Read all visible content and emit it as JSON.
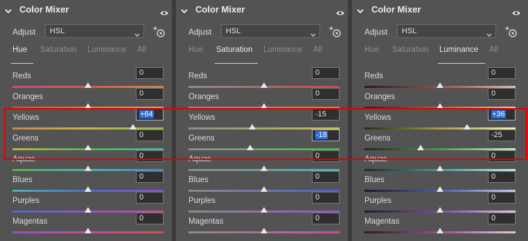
{
  "panels": [
    {
      "title": "Color Mixer",
      "adjust_label": "Adjust",
      "adjust_value": "HSL",
      "tabs": [
        "Hue",
        "Saturation",
        "Luminance",
        "All"
      ],
      "active_tab": 0,
      "rows": [
        {
          "label": "Reds",
          "value": "0",
          "slider": 0.5,
          "track": "linear-gradient(90deg,#c14f8c,#c9604a,#c98a4a)"
        },
        {
          "label": "Oranges",
          "value": "0",
          "slider": 0.5,
          "track": "linear-gradient(90deg,#c5584f,#c98a4a,#c7b64d)"
        },
        {
          "label": "Yellows",
          "value": "+64",
          "slider": 0.8,
          "selected": true,
          "track": "linear-gradient(90deg,#c98a4a,#c7b64d,#8fb84e)"
        },
        {
          "label": "Greens",
          "value": "0",
          "slider": 0.5,
          "track": "linear-gradient(90deg,#b4b74c,#5cb04f,#4eb49a)"
        },
        {
          "label": "Aquas",
          "value": "0",
          "slider": 0.5,
          "track": "linear-gradient(90deg,#5cb04f,#4cb3b5,#4d87c3)"
        },
        {
          "label": "Blues",
          "value": "0",
          "slider": 0.5,
          "track": "linear-gradient(90deg,#4cb3b5,#4f6cc6,#8a4fc3)"
        },
        {
          "label": "Purples",
          "value": "0",
          "slider": 0.5,
          "track": "linear-gradient(90deg,#4f6cc6,#9a4fc3,#c14f9e)"
        },
        {
          "label": "Magentas",
          "value": "0",
          "slider": 0.5,
          "track": "linear-gradient(90deg,#9a4fc3,#c14f9e,#c5584f)"
        }
      ]
    },
    {
      "title": "Color Mixer",
      "adjust_label": "Adjust",
      "adjust_value": "HSL",
      "tabs": [
        "Hue",
        "Saturation",
        "Luminance",
        "All"
      ],
      "active_tab": 1,
      "rows": [
        {
          "label": "Reds",
          "value": "0",
          "slider": 0.5,
          "track": "linear-gradient(90deg,#8c8c8c,#c94a4a)"
        },
        {
          "label": "Oranges",
          "value": "0",
          "slider": 0.5,
          "track": "linear-gradient(90deg,#8c8c8c,#c98a4a)"
        },
        {
          "label": "Yellows",
          "value": "-15",
          "slider": 0.42,
          "track": "linear-gradient(90deg,#8c8c8c,#c7c24d)"
        },
        {
          "label": "Greens",
          "value": "-18",
          "slider": 0.41,
          "selected": true,
          "track": "linear-gradient(90deg,#8c8c8c,#4fb550)"
        },
        {
          "label": "Aquas",
          "value": "0",
          "slider": 0.5,
          "track": "linear-gradient(90deg,#8c8c8c,#4cb6b8)"
        },
        {
          "label": "Blues",
          "value": "0",
          "slider": 0.5,
          "track": "linear-gradient(90deg,#8c8c8c,#4f5ec9)"
        },
        {
          "label": "Purples",
          "value": "0",
          "slider": 0.5,
          "track": "linear-gradient(90deg,#8c8c8c,#9a4fc9)"
        },
        {
          "label": "Magentas",
          "value": "0",
          "slider": 0.5,
          "track": "linear-gradient(90deg,#8c8c8c,#c94fa8)"
        }
      ]
    },
    {
      "title": "Color Mixer",
      "adjust_label": "Adjust",
      "adjust_value": "HSL",
      "tabs": [
        "Hue",
        "Saturation",
        "Luminance",
        "All"
      ],
      "active_tab": 2,
      "rows": [
        {
          "label": "Reds",
          "value": "0",
          "slider": 0.5,
          "track": "linear-gradient(90deg,#2a1a1a,#9a5050,#e6b8b8)"
        },
        {
          "label": "Oranges",
          "value": "0",
          "slider": 0.5,
          "track": "linear-gradient(90deg,#2a2018,#a07040,#ead2b0)"
        },
        {
          "label": "Yellows",
          "value": "+36",
          "slider": 0.68,
          "selected": true,
          "track": "linear-gradient(90deg,#2a2a18,#a6a045,#f0ecb8)"
        },
        {
          "label": "Greens",
          "value": "-25",
          "slider": 0.37,
          "track": "linear-gradient(90deg,#182a18,#4f9a50,#c4ecc2)"
        },
        {
          "label": "Aquas",
          "value": "0",
          "slider": 0.5,
          "track": "linear-gradient(90deg,#182a2a,#4a9a9a,#c2ecec)"
        },
        {
          "label": "Blues",
          "value": "0",
          "slider": 0.5,
          "track": "linear-gradient(90deg,#18182a,#4f5ea6,#c4caee)"
        },
        {
          "label": "Purples",
          "value": "0",
          "slider": 0.5,
          "track": "linear-gradient(90deg,#22182a,#7a50a6,#dcc4ee)"
        },
        {
          "label": "Magentas",
          "value": "0",
          "slider": 0.5,
          "track": "linear-gradient(90deg,#2a1824,#a0508a,#eec4e0)"
        }
      ]
    }
  ],
  "colors": {
    "highlight_box": "#e00000",
    "selection": "#2b6cd4"
  }
}
